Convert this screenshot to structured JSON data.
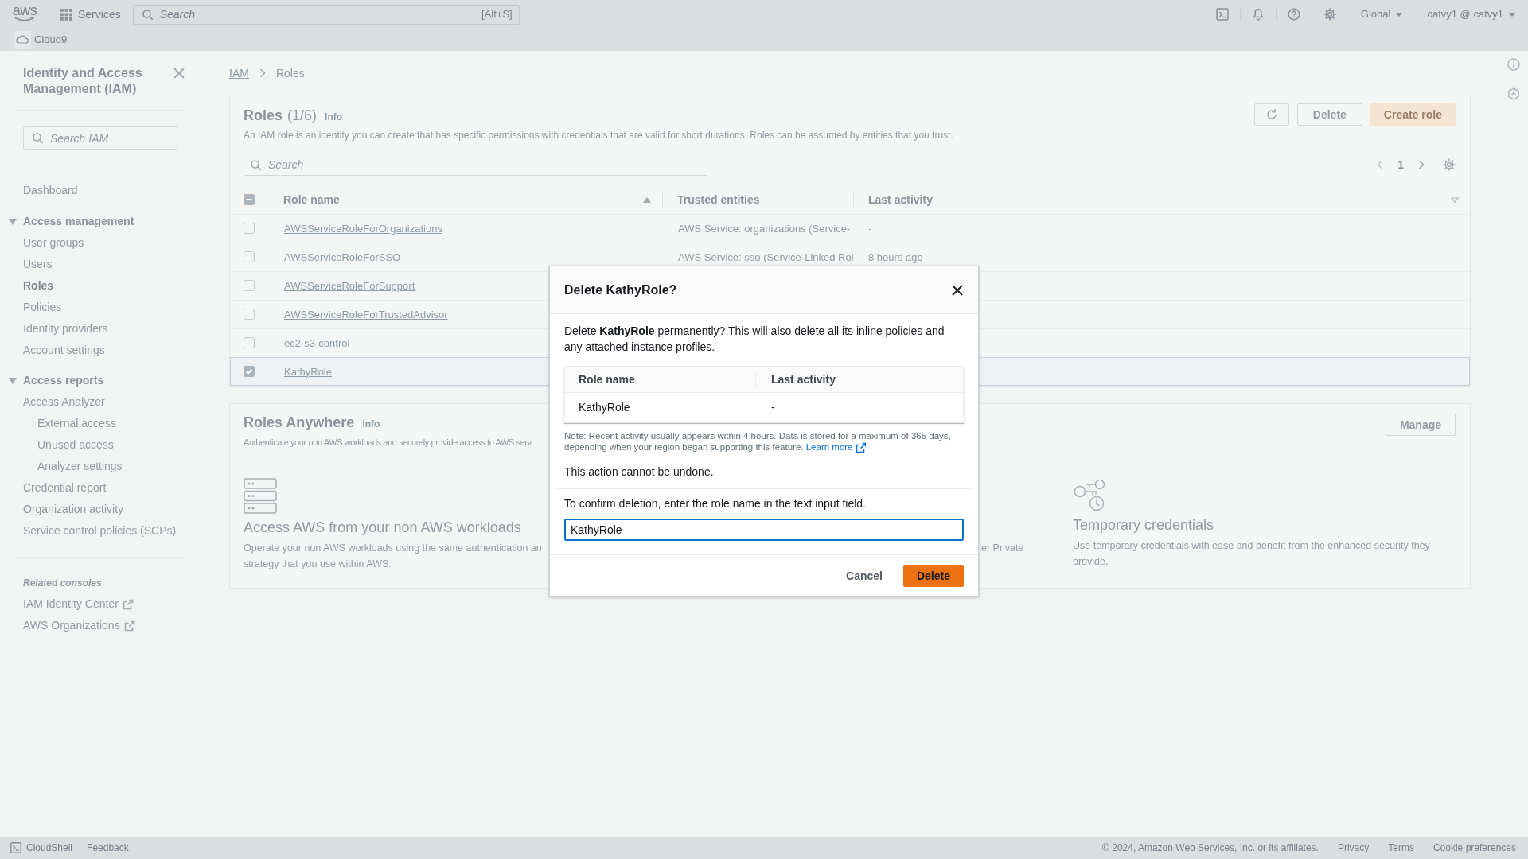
{
  "top_bar": {
    "logo": "aws",
    "services": "Services",
    "search": {
      "placeholder": "Search",
      "shortcut": "[Alt+S]"
    },
    "region": "Global",
    "account": "catvy1 @ catvy1"
  },
  "favorites": [
    {
      "label": "Cloud9"
    }
  ],
  "sidebar": {
    "title": "Identity and Access Management (IAM)",
    "search": {
      "placeholder": "Search IAM"
    },
    "links": [
      {
        "label": "Dashboard",
        "selected": false
      }
    ],
    "sections": [
      {
        "title": "Access management",
        "expanded": true,
        "items": [
          {
            "label": "User groups",
            "selected": false
          },
          {
            "label": "Users",
            "selected": false
          },
          {
            "label": "Roles",
            "selected": true
          },
          {
            "label": "Policies",
            "selected": false
          },
          {
            "label": "Identity providers",
            "selected": false
          },
          {
            "label": "Account settings",
            "selected": false
          }
        ]
      },
      {
        "title": "Access reports",
        "expanded": true,
        "items": [
          {
            "label": "Access Analyzer",
            "selected": false,
            "children": [
              {
                "label": "External access",
                "selected": false
              },
              {
                "label": "Unused access",
                "selected": false
              },
              {
                "label": "Analyzer settings",
                "selected": false
              }
            ]
          },
          {
            "label": "Credential report",
            "selected": false
          },
          {
            "label": "Organization activity",
            "selected": false
          },
          {
            "label": "Service control policies (SCPs)",
            "selected": false
          }
        ]
      }
    ],
    "related": {
      "title": "Related consoles",
      "items": [
        {
          "label": "IAM Identity Center",
          "external": true
        },
        {
          "label": "AWS Organizations",
          "external": true
        }
      ]
    }
  },
  "breadcrumb": [
    {
      "label": "IAM"
    },
    {
      "label": "Roles"
    }
  ],
  "roles": {
    "title": "Roles",
    "count": "(1/6)",
    "info": "Info",
    "description": "An IAM role is an identity you can create that has specific permissions with credentials that are valid for short durations. Roles can be assumed by entities that you trust.",
    "actions": [
      {
        "kind": "refresh"
      },
      {
        "kind": "normal",
        "label": "Delete"
      },
      {
        "kind": "primary",
        "label": "Create role"
      }
    ],
    "search": {
      "placeholder": "Search"
    },
    "pagination": {
      "page": "1"
    },
    "table": {
      "select_all": {
        "checked": false,
        "indeterminate": true
      },
      "columns": [
        {
          "label": "Role name",
          "sortable": true,
          "sorted": true
        },
        {
          "label": "Trusted entities",
          "sortable": false,
          "sorted": false
        },
        {
          "label": "Last activity",
          "sortable": true,
          "sorted": false
        }
      ],
      "rows": [
        {
          "role_name": "AWSServiceRoleForOrganizations",
          "trusted_entities": "AWS Service: organizations (Service-",
          "last_activity": "-",
          "selected": false
        },
        {
          "role_name": "AWSServiceRoleForSSO",
          "trusted_entities": "AWS Service: sso (Service-Linked Rol",
          "last_activity": "8 hours ago",
          "selected": false
        },
        {
          "role_name": "AWSServiceRoleForSupport",
          "selected": false
        },
        {
          "role_name": "AWSServiceRoleForTrustedAdvisor",
          "selected": false
        },
        {
          "role_name": "ec2-s3-control",
          "selected": false
        },
        {
          "role_name": "KathyRole",
          "selected": true
        }
      ]
    }
  },
  "roles_anywhere": {
    "title": "Roles Anywhere",
    "info": "Info",
    "description": "Authenticate your non AWS workloads and securely provide access to AWS serv",
    "button": "Manage",
    "features": [
      {
        "kind": "workloads",
        "title": "Access AWS from your non AWS workloads",
        "description": "Operate your non AWS workloads using the same authentication an\nstrategy that you use within AWS."
      },
      {
        "kind": "covered",
        "description": "er Private"
      },
      {
        "kind": "credentials",
        "title": "Temporary credentials",
        "description": "Use temporary credentials with ease and benefit from the enhanced security they provide."
      }
    ]
  },
  "dialog": {
    "title": "Delete KathyRole?",
    "message": "Delete **KathyRole** permanently? This will also delete all its inline policies and any attached instance profiles.",
    "table": {
      "columns": [
        "Role name",
        "Last activity"
      ],
      "rows": [
        [
          "KathyRole",
          "-"
        ]
      ]
    },
    "note": "Note: Recent activity usually appears within 4 hours. Data is stored for a maximum of 365 days, depending when your region began supporting this feature.",
    "note_link": "Learn more",
    "warning": "This action cannot be undone.",
    "confirm_label": "To confirm deletion, enter the role name in the text input field.",
    "confirm_value": "KathyRole",
    "confirm_focused": true,
    "buttons": [
      {
        "kind": "link",
        "label": "Cancel"
      },
      {
        "kind": "primary",
        "label": "Delete"
      }
    ]
  },
  "footer": {
    "items": [
      {
        "kind": "shell",
        "label": "CloudShell"
      },
      {
        "kind": "text",
        "label": "Feedback"
      }
    ],
    "copyright": "© 2024, Amazon Web Services, Inc. or its affiliates.",
    "links": [
      "Privacy",
      "Terms",
      "Cookie preferences"
    ]
  }
}
